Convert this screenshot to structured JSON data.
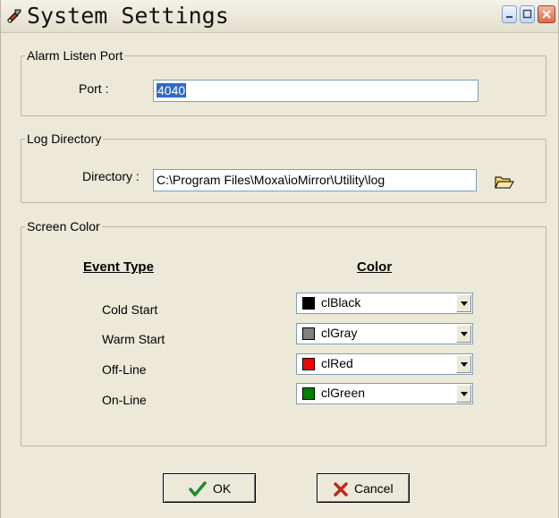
{
  "window": {
    "title": "System Settings"
  },
  "alarm_listen_port": {
    "legend": "Alarm Listen Port",
    "port_label": "Port :",
    "port_value": "4040"
  },
  "log_directory": {
    "legend": "Log Directory",
    "directory_label": "Directory :",
    "directory_value": "C:\\Program Files\\Moxa\\ioMirror\\Utility\\log"
  },
  "screen_color": {
    "legend": "Screen Color",
    "event_type_header": "Event Type",
    "color_header": "Color",
    "rows": [
      {
        "event": "Cold Start",
        "color_name": "clBlack",
        "swatch": "#000000"
      },
      {
        "event": "Warm Start",
        "color_name": "clGray",
        "swatch": "#808080"
      },
      {
        "event": "Off-Line",
        "color_name": "clRed",
        "swatch": "#ff0000"
      },
      {
        "event": "On-Line",
        "color_name": "clGreen",
        "swatch": "#008000"
      }
    ]
  },
  "buttons": {
    "ok": "OK",
    "cancel": "Cancel"
  },
  "icons": {
    "app": "tools-icon",
    "folder": "folder-open-icon",
    "ok": "checkmark-icon",
    "cancel": "x-icon"
  }
}
